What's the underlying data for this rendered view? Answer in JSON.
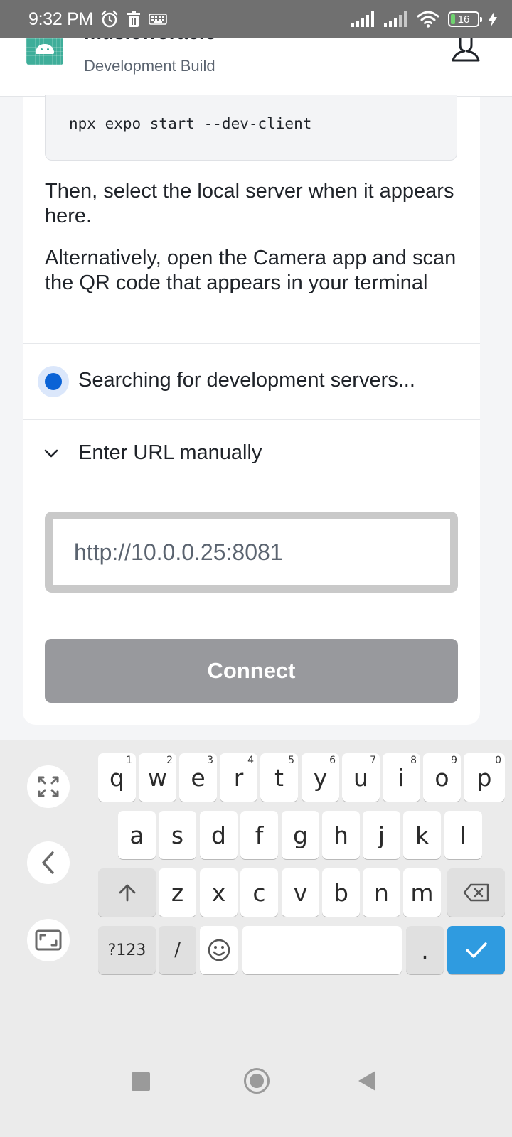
{
  "status_bar": {
    "time": "9:32 PM",
    "battery_level": "16",
    "left_icons": [
      "alarm-icon",
      "trash-icon",
      "keyboard-icon"
    ],
    "right_icons": [
      "signal-icon",
      "signal-icon",
      "wifi-icon",
      "battery-icon",
      "charging-icon"
    ]
  },
  "header": {
    "app_name": "musicworaclo",
    "subtitle": "Development Build",
    "user_icon": "user-icon"
  },
  "main": {
    "command": "npx expo start --dev-client",
    "instruction_1": "Then, select the local server when it appears here.",
    "instruction_2": "Alternatively, open the Camera app and scan the QR code that appears in your terminal",
    "searching_text": "Searching for development servers...",
    "enter_url_label": "Enter URL manually",
    "url_value": "http://10.0.0.25:8081",
    "connect_label": "Connect"
  },
  "keyboard": {
    "row1": [
      {
        "key": "q",
        "hint": "1"
      },
      {
        "key": "w",
        "hint": "2"
      },
      {
        "key": "e",
        "hint": "3"
      },
      {
        "key": "r",
        "hint": "4"
      },
      {
        "key": "t",
        "hint": "5"
      },
      {
        "key": "y",
        "hint": "6"
      },
      {
        "key": "u",
        "hint": "7"
      },
      {
        "key": "i",
        "hint": "8"
      },
      {
        "key": "o",
        "hint": "9"
      },
      {
        "key": "p",
        "hint": "0"
      }
    ],
    "row2": [
      "a",
      "s",
      "d",
      "f",
      "g",
      "h",
      "j",
      "k",
      "l"
    ],
    "row3": [
      "z",
      "x",
      "c",
      "v",
      "b",
      "n",
      "m"
    ],
    "symbols_label": "?123",
    "slash_label": "/",
    "period_label": ".",
    "side_icons": [
      "expand-icon",
      "back-arrow-icon",
      "resize-icon"
    ]
  },
  "nav": {
    "icons": [
      "recents-icon",
      "home-icon",
      "back-icon"
    ]
  },
  "colors": {
    "status_bar": "#707070",
    "radio_accent": "#0b63d6",
    "connect_button": "#98999d",
    "enter_key": "#2f9be0",
    "keyboard_bg": "#ebebeb"
  }
}
